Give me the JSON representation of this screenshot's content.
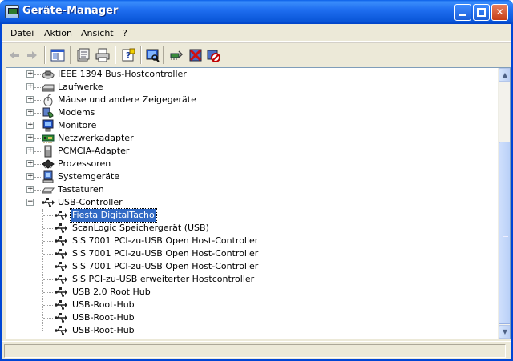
{
  "window": {
    "title": "Geräte-Manager"
  },
  "menu": {
    "items": [
      "Datei",
      "Aktion",
      "Ansicht",
      "?"
    ]
  },
  "toolbar": {
    "icons": [
      "back-icon",
      "forward-icon",
      "show-hide-tree-icon",
      "properties-icon",
      "print-icon",
      "help-icon",
      "scan-hardware-icon",
      "update-driver-icon",
      "uninstall-icon",
      "disable-icon"
    ]
  },
  "tree": {
    "categories": [
      {
        "label": "IEEE 1394 Bus-Hostcontroller",
        "icon": "ieee1394-icon"
      },
      {
        "label": "Laufwerke",
        "icon": "drive-icon"
      },
      {
        "label": "Mäuse und andere Zeigegeräte",
        "icon": "mouse-icon"
      },
      {
        "label": "Modems",
        "icon": "modem-icon"
      },
      {
        "label": "Monitore",
        "icon": "monitor-icon"
      },
      {
        "label": "Netzwerkadapter",
        "icon": "network-adapter-icon"
      },
      {
        "label": "PCMCIA-Adapter",
        "icon": "pcmcia-icon"
      },
      {
        "label": "Prozessoren",
        "icon": "processor-icon"
      },
      {
        "label": "Systemgeräte",
        "icon": "system-device-icon"
      },
      {
        "label": "Tastaturen",
        "icon": "keyboard-icon"
      }
    ],
    "usb_controller": {
      "label": "USB-Controller",
      "icon": "usb-icon",
      "children": [
        "Fiesta DigitalTacho",
        "ScanLogic Speichergerät (USB)",
        "SiS 7001 PCI-zu-USB Open Host-Controller",
        "SiS 7001 PCI-zu-USB Open Host-Controller",
        "SiS 7001 PCI-zu-USB Open Host-Controller",
        "SiS PCI-zu-USB erweiterter Hostcontroller",
        "USB 2.0 Root Hub",
        "USB-Root-Hub",
        "USB-Root-Hub",
        "USB-Root-Hub"
      ],
      "selected_index": 0
    }
  },
  "colors": {
    "titlebar": "#0a56d8",
    "selection": "#316ac5",
    "window_bg": "#ece9d8"
  }
}
